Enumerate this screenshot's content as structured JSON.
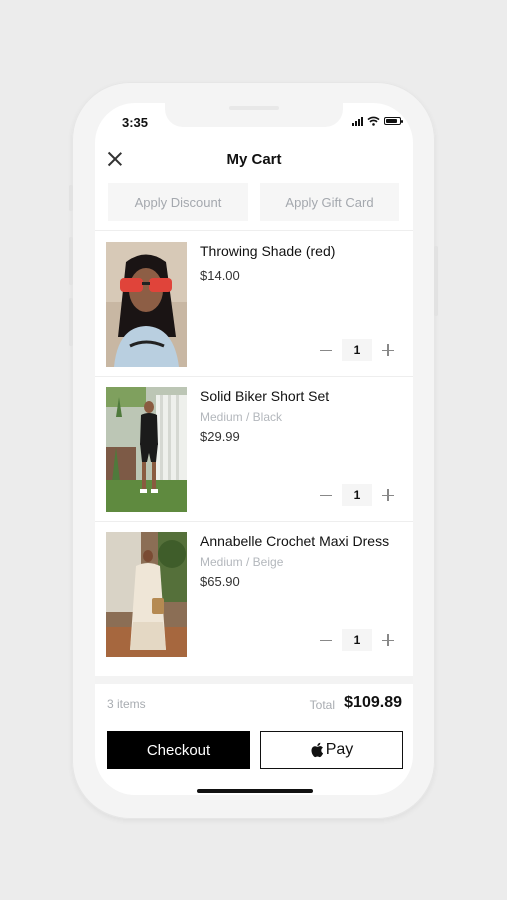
{
  "status": {
    "time": "3:35"
  },
  "header": {
    "title": "My Cart"
  },
  "promos": {
    "discount": "Apply Discount",
    "gift_card": "Apply Gift Card"
  },
  "items": [
    {
      "name": "Throwing Shade (red)",
      "variant": "",
      "price": "$14.00",
      "qty": "1"
    },
    {
      "name": "Solid Biker Short Set",
      "variant": "Medium / Black",
      "price": "$29.99",
      "qty": "1"
    },
    {
      "name": "Annabelle Crochet Maxi Dress",
      "variant": "Medium / Beige",
      "price": "$65.90",
      "qty": "1"
    }
  ],
  "summary": {
    "count": "3 items",
    "total_label": "Total",
    "total": "$109.89"
  },
  "actions": {
    "checkout": "Checkout",
    "apple_pay": "Pay"
  },
  "colors": {
    "checkout_bg": "#000000",
    "muted": "#a4a8ae"
  },
  "icons": [
    "close-icon",
    "minus-icon",
    "plus-icon",
    "apple-icon",
    "wifi-icon",
    "battery-icon",
    "signal-icon"
  ]
}
